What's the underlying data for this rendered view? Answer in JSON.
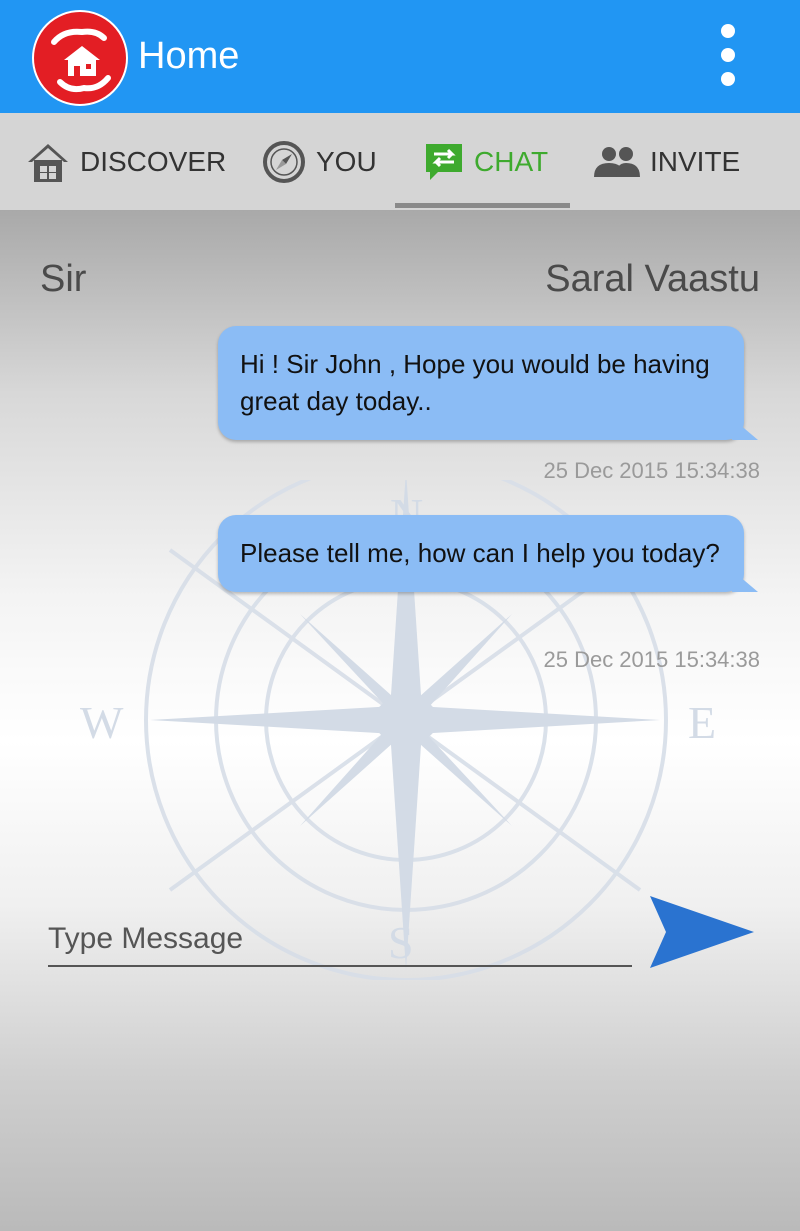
{
  "appbar": {
    "title": "Home"
  },
  "tabs": [
    {
      "label": "DISCOVER",
      "icon": "house-icon"
    },
    {
      "label": "YOU",
      "icon": "compass-icon"
    },
    {
      "label": "CHAT",
      "icon": "chat-swap-icon",
      "active": true
    },
    {
      "label": "INVITE",
      "icon": "people-icon"
    }
  ],
  "chat": {
    "left_name": "Sir",
    "right_name": "Saral Vaastu",
    "messages": [
      {
        "text": "Hi ! Sir John , Hope you would be having great day today..",
        "timestamp": "25 Dec 2015 15:34:38"
      },
      {
        "text": "Please tell me, how can I help you today?",
        "timestamp": "25 Dec 2015 15:34:38"
      }
    ]
  },
  "compose": {
    "placeholder": "Type Message"
  },
  "colors": {
    "appbar": "#2196f3",
    "active_tab": "#3eaa2e",
    "bubble": "#8bbcf5",
    "send": "#2a73d0",
    "logo": "#e31e24"
  }
}
